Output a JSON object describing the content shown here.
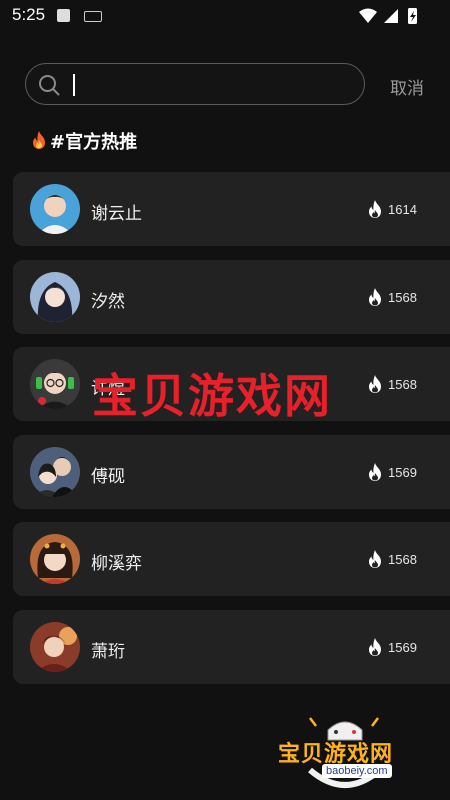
{
  "status_bar": {
    "time": "5:25"
  },
  "search": {
    "value": "",
    "placeholder": ""
  },
  "cancel_label": "取消",
  "section_title": "#官方热推",
  "items": [
    {
      "name": "谢云止",
      "heat": "1614",
      "avatar_color": "#4aa3d8"
    },
    {
      "name": "汐然",
      "heat": "1568",
      "avatar_color": "#9bb6d6"
    },
    {
      "name": "许煜",
      "heat": "1568",
      "avatar_color": "#3a3a3a"
    },
    {
      "name": "傅砚",
      "heat": "1569",
      "avatar_color": "#4d5f7a"
    },
    {
      "name": "柳溪弈",
      "heat": "1568",
      "avatar_color": "#b86a3a"
    },
    {
      "name": "萧珩",
      "heat": "1569",
      "avatar_color": "#8a3b2a"
    }
  ],
  "watermark": {
    "center": "宝贝游戏网",
    "corner": "宝贝游戏网",
    "url": "baobeiy.com"
  }
}
